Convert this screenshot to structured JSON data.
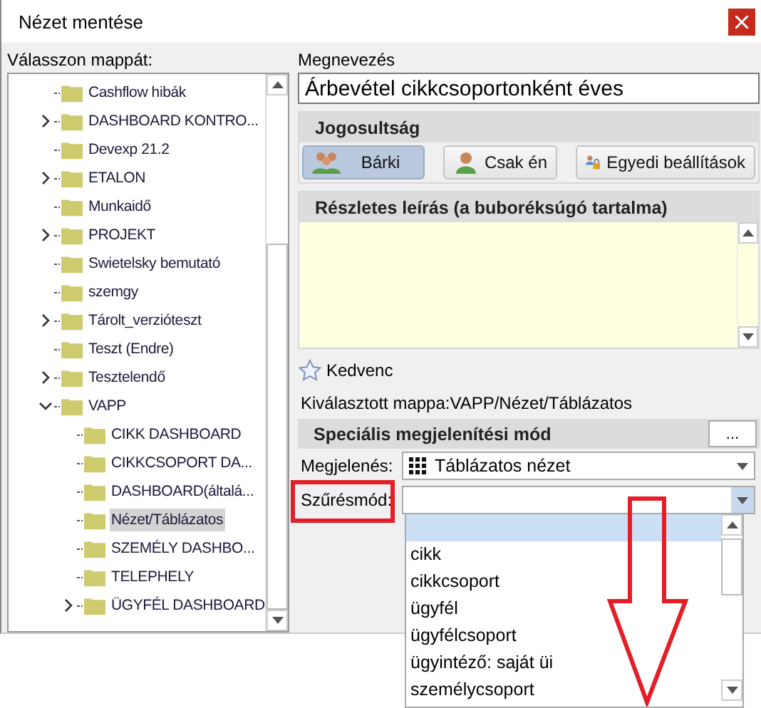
{
  "window": {
    "title": "Nézet mentése"
  },
  "folder_tree": {
    "label": "Válasszon mappát:",
    "items": [
      {
        "label": "Cashflow hibák",
        "has_children": false,
        "expanded": false,
        "selected": false
      },
      {
        "label": "DASHBOARD KONTRO...",
        "has_children": true,
        "expanded": false,
        "selected": false
      },
      {
        "label": "Devexp 21.2",
        "has_children": false,
        "expanded": false,
        "selected": false
      },
      {
        "label": "ETALON",
        "has_children": true,
        "expanded": false,
        "selected": false
      },
      {
        "label": "Munkaidő",
        "has_children": false,
        "expanded": false,
        "selected": false
      },
      {
        "label": "PROJEKT",
        "has_children": true,
        "expanded": false,
        "selected": false
      },
      {
        "label": "Swietelsky bemutató",
        "has_children": false,
        "expanded": false,
        "selected": false
      },
      {
        "label": "szemgy",
        "has_children": false,
        "expanded": false,
        "selected": false
      },
      {
        "label": "Tárolt_verzióteszt",
        "has_children": true,
        "expanded": false,
        "selected": false
      },
      {
        "label": "Teszt (Endre)",
        "has_children": false,
        "expanded": false,
        "selected": false
      },
      {
        "label": "Tesztelendő",
        "has_children": true,
        "expanded": false,
        "selected": false
      },
      {
        "label": "VAPP",
        "has_children": true,
        "expanded": true,
        "selected": false,
        "children": [
          {
            "label": "CIKK DASHBOARD",
            "has_children": false,
            "expanded": false,
            "selected": false
          },
          {
            "label": "CIKKCSOPORT DA...",
            "has_children": false,
            "expanded": false,
            "selected": false
          },
          {
            "label": "DASHBOARD(általá...",
            "has_children": false,
            "expanded": false,
            "selected": false
          },
          {
            "label": "Nézet/Táblázatos",
            "has_children": false,
            "expanded": false,
            "selected": true
          },
          {
            "label": "SZEMÉLY DASHBO...",
            "has_children": false,
            "expanded": false,
            "selected": false
          },
          {
            "label": "TELEPHELY",
            "has_children": false,
            "expanded": false,
            "selected": false
          },
          {
            "label": "ÜGYFÉL DASHBOARD",
            "has_children": true,
            "expanded": false,
            "selected": false
          }
        ]
      }
    ]
  },
  "name_field": {
    "label": "Megnevezés",
    "value": "Árbevétel cikkcsoportonként éves"
  },
  "permissions": {
    "title": "Jogosultság",
    "options": [
      {
        "label": "Bárki",
        "kind": "group",
        "selected": true
      },
      {
        "label": "Csak én",
        "kind": "person",
        "selected": false
      },
      {
        "label": "Egyedi beállítások",
        "kind": "lock",
        "selected": false
      }
    ]
  },
  "description": {
    "title": "Részletes leírás (a buboréksúgó tartalma)"
  },
  "favorite": {
    "label": "Kedvenc",
    "checked": false
  },
  "selected_folder": "Kiválasztott mappa:VAPP/Nézet/Táblázatos",
  "display_mode": {
    "title": "Speciális megjelenítési mód",
    "more_button": "...",
    "fields": [
      {
        "label": "Megjelenés:",
        "kind": "grid",
        "value": "Táblázatos nézet",
        "open": false
      },
      {
        "label": "Szűrésmód:",
        "kind": "plain",
        "open": true,
        "options": [
          {
            "selected": true
          },
          {
            "label": "cikk",
            "selected": false
          },
          {
            "label": "cikkcsoport",
            "selected": false
          },
          {
            "label": "ügyfél",
            "selected": false
          },
          {
            "label": "ügyfélcsoport",
            "selected": false
          },
          {
            "label": "ügyintéző: saját üi",
            "selected": false
          },
          {
            "label": "személycsoport",
            "selected": false
          }
        ]
      }
    ]
  }
}
